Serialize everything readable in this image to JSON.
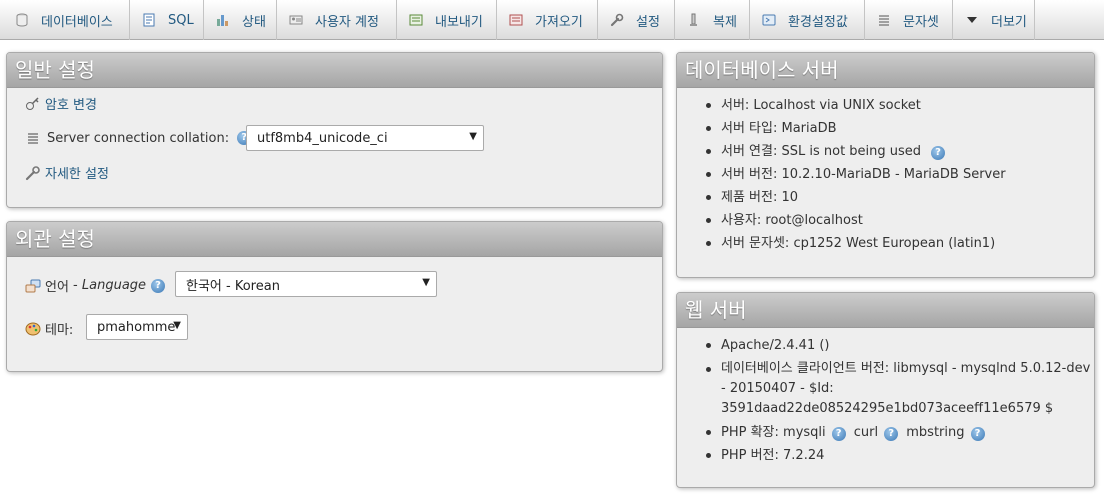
{
  "tabs": [
    {
      "label": "데이터베이스",
      "icon": "database-icon"
    },
    {
      "label": "SQL",
      "icon": "sql-icon"
    },
    {
      "label": "상태",
      "icon": "status-chart-icon"
    },
    {
      "label": "사용자 계정",
      "icon": "user-accounts-icon"
    },
    {
      "label": "내보내기",
      "icon": "export-icon"
    },
    {
      "label": "가져오기",
      "icon": "import-icon"
    },
    {
      "label": "설정",
      "icon": "wrench-icon"
    },
    {
      "label": "복제",
      "icon": "replication-icon"
    },
    {
      "label": "환경설정값",
      "icon": "variables-icon"
    },
    {
      "label": "문자셋",
      "icon": "charset-icon"
    },
    {
      "label": "더보기",
      "icon": "dropdown-triangle-icon"
    }
  ],
  "general": {
    "title": "일반 설정",
    "change_password": "암호 변경",
    "collation_label": "Server connection collation:",
    "collation_value": "utf8mb4_unicode_ci",
    "more_settings": "자세한 설정"
  },
  "appearance": {
    "title": "외관 설정",
    "language_label": "언어",
    "language_sep": " - ",
    "language_en": "Language",
    "language_value": "한국어 - Korean",
    "theme_label": "테마:",
    "theme_value": "pmahomme"
  },
  "db_server": {
    "title": "데이터베이스 서버",
    "items": [
      "서버: Localhost via UNIX socket",
      "서버 타입: MariaDB",
      "서버 연결: SSL is not being used",
      "서버 버전: 10.2.10-MariaDB - MariaDB Server",
      "제품 버전: 10",
      "사용자: root@localhost",
      "서버 문자셋: cp1252 West European (latin1)"
    ]
  },
  "web_server": {
    "title": "웹 서버",
    "apache": "Apache/2.4.41 ()",
    "client_line1": "데이터베이스 클라이언트 버전: libmysql - mysqlnd 5.0.12-dev",
    "client_line2": "- 20150407 - $Id:",
    "client_line3": "3591daad22de08524295e1bd073aceeff11e6579 $",
    "php_ext_label": "PHP 확장:",
    "php_ext_1": "mysqli",
    "php_ext_2": "curl",
    "php_ext_3": "mbstring",
    "php_version": "PHP 버전: 7.2.24"
  },
  "colors": {
    "link": "#235a81",
    "panel_header": "#a5a5a5",
    "panel_bg": "#eeeeee"
  }
}
